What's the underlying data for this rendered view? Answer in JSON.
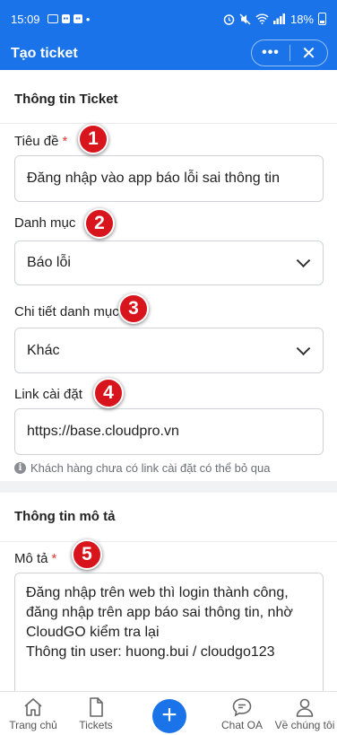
{
  "status_bar": {
    "time": "15:09",
    "battery": "18%",
    "accent": "#1a73e8"
  },
  "app_bar": {
    "title": "Tạo ticket",
    "more_label": "•••",
    "close_label": "✕"
  },
  "ticket_section": {
    "title": "Thông tin Ticket",
    "subject": {
      "label": "Tiêu đề",
      "required_mark": "*",
      "value": "Đăng nhập vào app báo lỗi sai thông tin"
    },
    "category": {
      "label": "Danh mục",
      "value": "Báo lỗi"
    },
    "category_detail": {
      "label": "Chi tiết danh mục",
      "value": "Khác"
    },
    "install_link": {
      "label": "Link cài đặt",
      "value": "https://base.cloudpro.vn"
    },
    "hint": "Khách hàng chưa có link cài đặt có thể bỏ qua"
  },
  "description_section": {
    "title": "Thông tin mô tả",
    "description": {
      "label": "Mô tả",
      "required_mark": "*",
      "value": "Đăng nhập trên web thì login thành công, đăng nhập trên app báo sai thông tin, nhờ CloudGO kiểm tra lại\nThông tin user: huong.bui / cloudgo123"
    }
  },
  "markers": [
    "1",
    "2",
    "3",
    "4",
    "5"
  ],
  "bottom_nav": {
    "home": "Trang chủ",
    "tickets": "Tickets",
    "add": "+",
    "chat": "Chat OA",
    "about": "Về chúng tôi"
  }
}
